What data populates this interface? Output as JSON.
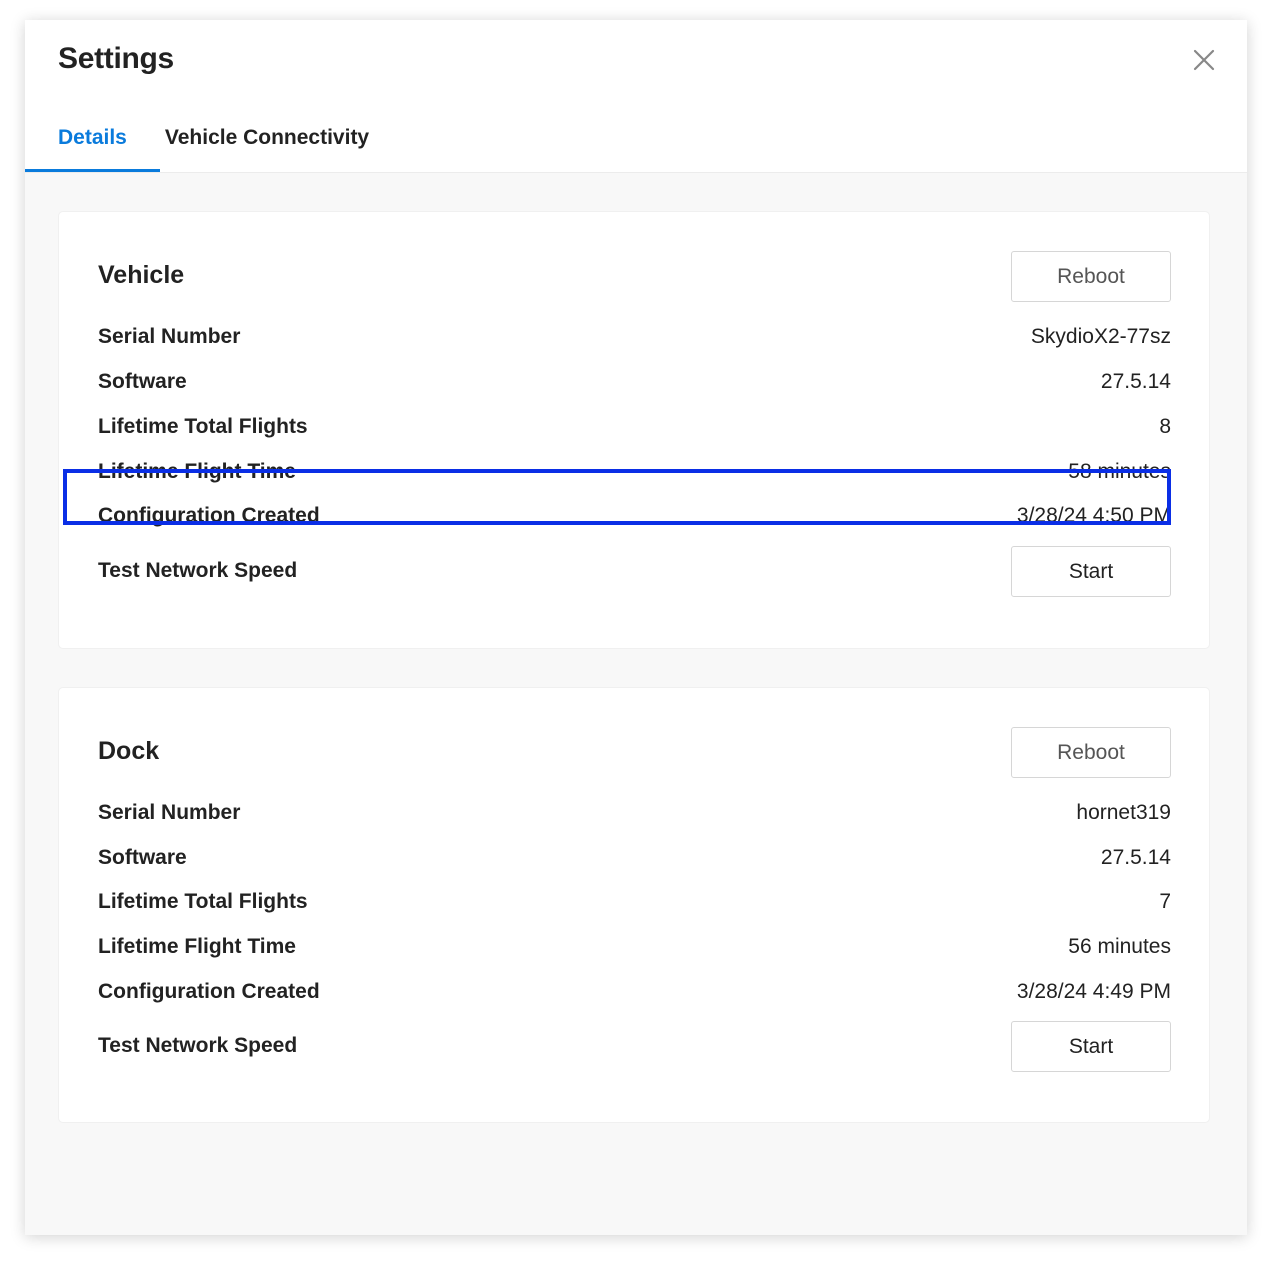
{
  "modal": {
    "title": "Settings",
    "close_icon": "close-icon"
  },
  "tabs": [
    {
      "label": "Details",
      "active": true
    },
    {
      "label": "Vehicle Connectivity",
      "active": false
    }
  ],
  "vehicle": {
    "title": "Vehicle",
    "reboot_label": "Reboot",
    "rows": [
      {
        "label": "Serial Number",
        "value": "SkydioX2-77sz"
      },
      {
        "label": "Software",
        "value": "27.5.14"
      },
      {
        "label": "Lifetime Total Flights",
        "value": "8"
      },
      {
        "label": "Lifetime Flight Time",
        "value": "58 minutes"
      },
      {
        "label": "Configuration Created",
        "value": "3/28/24 4:50 PM"
      }
    ],
    "network": {
      "label": "Test Network Speed",
      "button": "Start"
    }
  },
  "dock": {
    "title": "Dock",
    "reboot_label": "Reboot",
    "rows": [
      {
        "label": "Serial Number",
        "value": "hornet319"
      },
      {
        "label": "Software",
        "value": "27.5.14"
      },
      {
        "label": "Lifetime Total Flights",
        "value": "7"
      },
      {
        "label": "Lifetime Flight Time",
        "value": "56 minutes"
      },
      {
        "label": "Configuration Created",
        "value": "3/28/24 4:49 PM"
      }
    ],
    "network": {
      "label": "Test Network Speed",
      "button": "Start"
    }
  },
  "colors": {
    "accent": "#0a7bdc",
    "highlight": "#0a2ee6"
  }
}
